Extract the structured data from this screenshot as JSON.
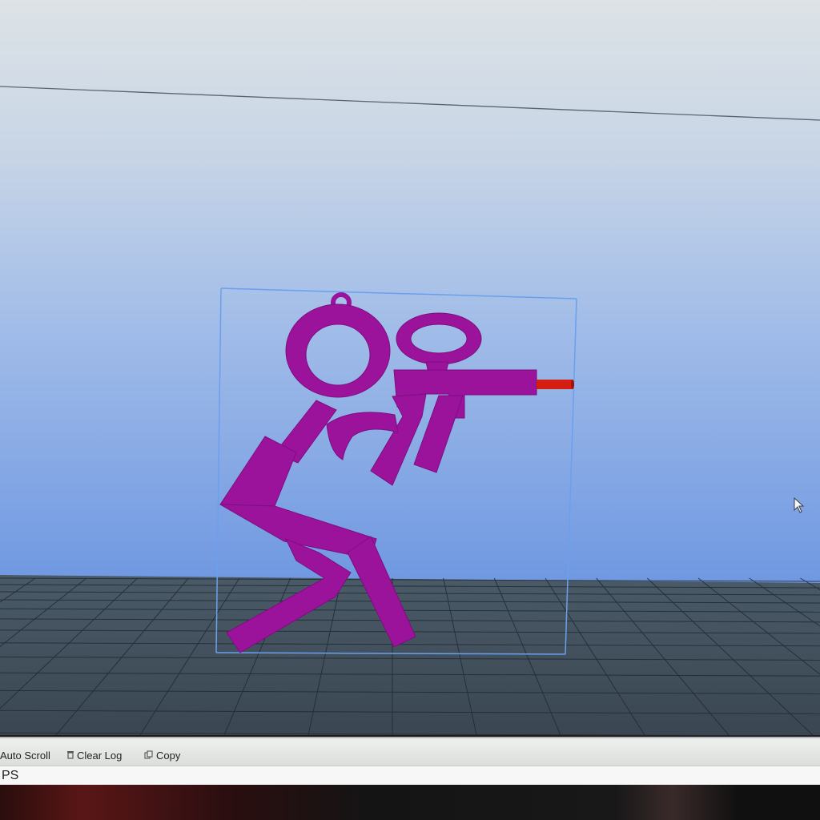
{
  "viewport": {
    "background_top": "#dde3e6",
    "background_bottom": "#6f98e2",
    "floor_color": "#465663",
    "grid_color": "#1f2a33",
    "bounding_box_color": "#6aa0ee",
    "model_color": "#9b139b",
    "barrel_color": "#d41e12"
  },
  "log_panel": {
    "auto_scroll_label": "Auto Scroll",
    "clear_log_label": "Clear Log",
    "copy_label": "Copy",
    "log_text": "PS"
  },
  "icons": {
    "clear_log": "trash-icon",
    "copy": "copy-icon",
    "cursor": "mouse-cursor-icon"
  }
}
